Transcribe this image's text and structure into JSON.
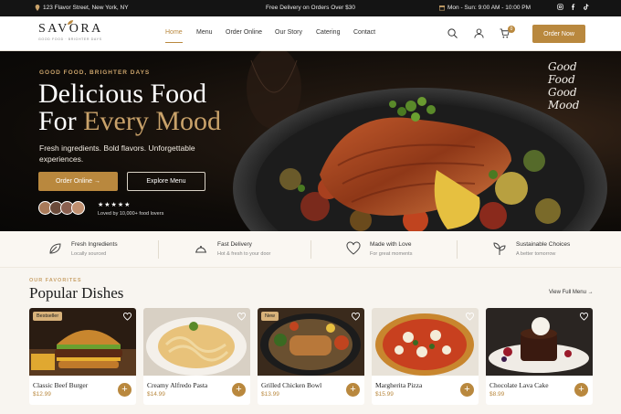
{
  "topbar": {
    "address": "123 Flavor Street, New York, NY",
    "promo": "Free Delivery on Orders Over $30",
    "hours": "Mon - Sun: 9:00 AM - 10:00 PM",
    "socials": [
      "instagram-icon",
      "facebook-icon",
      "tiktok-icon"
    ]
  },
  "brand": {
    "name": "SAVORA",
    "tagline": "GOOD FOOD · BRIGHTER DAYS"
  },
  "nav": {
    "items": [
      "Home",
      "Menu",
      "Order Online",
      "Our Story",
      "Catering",
      "Contact"
    ],
    "active": "Home",
    "cart_count": "0",
    "order_button": "Order Now"
  },
  "hero": {
    "eyebrow": "GOOD FOOD, BRIGHTER DAYS",
    "title_line1": "Delicious Food",
    "title_line2_prefix": "For ",
    "title_line2_accent": "Every Mood",
    "subtitle": "Fresh ingredients. Bold flavors. Unforgettable experiences.",
    "primary_button": "Order Online →",
    "secondary_button": "Explore Menu",
    "stars": "★★★★★",
    "loved_by": "Loved by 10,000+ food lovers",
    "script_text": [
      "Good",
      "Food",
      "Good",
      "Mood"
    ]
  },
  "features": [
    {
      "title": "Fresh Ingredients",
      "subtitle": "Locally sourced",
      "icon": "leaf-icon"
    },
    {
      "title": "Fast Delivery",
      "subtitle": "Hot & fresh to your door",
      "icon": "cloche-icon"
    },
    {
      "title": "Made with Love",
      "subtitle": "For great moments",
      "icon": "heart-icon"
    },
    {
      "title": "Sustainable Choices",
      "subtitle": "A better tomorrow",
      "icon": "sprout-icon"
    }
  ],
  "popular": {
    "label": "OUR FAVORITES",
    "title": "Popular Dishes",
    "view_all": "View Full Menu →",
    "dishes": [
      {
        "name": "Classic Beef Burger",
        "price": "$12.99",
        "badge": "Bestseller"
      },
      {
        "name": "Creamy Alfredo Pasta",
        "price": "$14.99",
        "badge": ""
      },
      {
        "name": "Grilled Chicken Bowl",
        "price": "$13.99",
        "badge": "New"
      },
      {
        "name": "Margherita Pizza",
        "price": "$15.99",
        "badge": ""
      },
      {
        "name": "Chocolate Lava Cake",
        "price": "$8.99",
        "badge": ""
      }
    ],
    "add_symbol": "+"
  },
  "colors": {
    "accent": "#b9883e",
    "dark": "#141414",
    "background": "#f8f5f0"
  }
}
